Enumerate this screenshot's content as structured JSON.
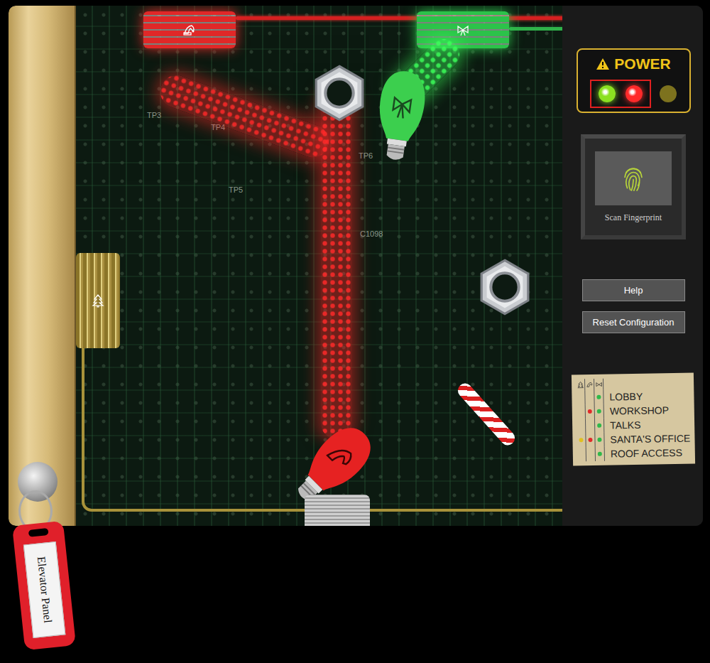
{
  "key_tag": {
    "label": "Elevator Panel"
  },
  "power": {
    "label": "POWER",
    "lights": [
      {
        "color": "#8be021",
        "on": true,
        "highlighted": true
      },
      {
        "color": "#ff2a2a",
        "on": true,
        "highlighted": true
      },
      {
        "color": "#d8c21a",
        "on": false,
        "highlighted": false
      }
    ]
  },
  "fingerprint": {
    "label": "Scan Fingerprint"
  },
  "buttons": [
    "Help",
    "Reset Configuration"
  ],
  "note": {
    "columns": [
      {
        "color": "#e0c020"
      },
      {
        "color": "#e02a2a"
      },
      {
        "color": "#2fb84a"
      }
    ],
    "floors": [
      {
        "name": "LOBBY",
        "marks": [
          false,
          false,
          true
        ]
      },
      {
        "name": "WORKSHOP",
        "marks": [
          false,
          true,
          true
        ]
      },
      {
        "name": "TALKS",
        "marks": [
          false,
          false,
          true
        ]
      },
      {
        "name": "SANTA'S OFFICE",
        "marks": [
          true,
          true,
          true
        ]
      },
      {
        "name": "ROOF ACCESS",
        "marks": [
          false,
          false,
          true
        ]
      }
    ]
  },
  "board": {
    "labels": [
      "TP3",
      "TP4",
      "TP5",
      "TP6",
      "C1098"
    ],
    "sockets": [
      {
        "color": "#e02828"
      },
      {
        "color": "#2cc24a"
      },
      {
        "color": "#c9a93a"
      }
    ],
    "bulbs": [
      {
        "color": "#3ccf4e"
      },
      {
        "color": "#e62222"
      }
    ],
    "beams": [
      {
        "color": "#ff2a2a"
      },
      {
        "color": "#3cff5a"
      }
    ]
  }
}
